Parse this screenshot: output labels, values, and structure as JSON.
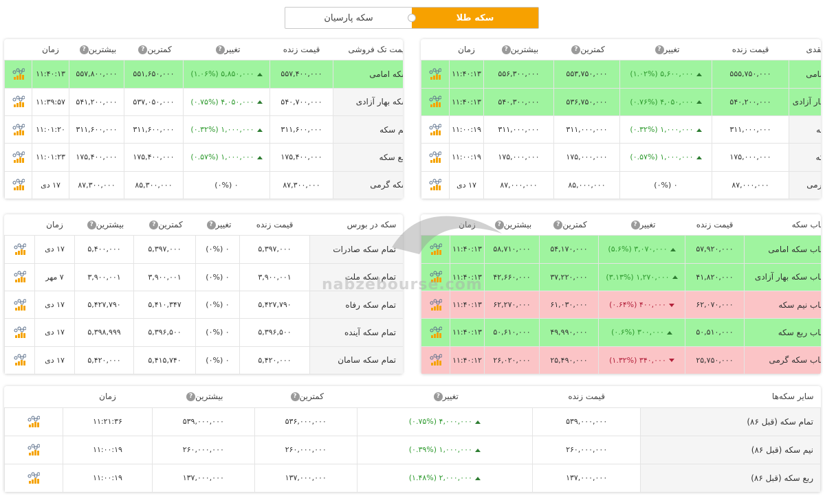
{
  "toggle": {
    "options": [
      "سکه طلا",
      "سکه پارسیان"
    ],
    "selected": "سکه طلا",
    "active_color": "#f7a100"
  },
  "colors": {
    "up_row": "#9ff49f",
    "down_row": "#fbc4c6",
    "up_text": "#2e9a2e",
    "down_text": "#b3203a"
  },
  "tables": {
    "cash": {
      "headers": [
        "قیمت نقدی",
        "قیمت زنده",
        "تغییر",
        "کمترین",
        "بیشترین",
        "زمان"
      ],
      "rows": [
        {
          "name": "سکه امامی",
          "live": "۵۵۵,۷۵۰,۰۰۰",
          "change": "۵,۶۰۰,۰۰۰ (۱.۰۲%)",
          "dir": "up",
          "low": "۵۵۳,۷۵۰,۰۰۰",
          "high": "۵۵۶,۳۰۰,۰۰۰",
          "time": "۱۱:۴۰:۱۳",
          "row_state": "up"
        },
        {
          "name": "سکه بهار آزادی",
          "live": "۵۴۰,۲۰۰,۰۰۰",
          "change": "۴,۰۵۰,۰۰۰ (۰.۷۶%)",
          "dir": "up",
          "low": "۵۳۶,۷۵۰,۰۰۰",
          "high": "۵۴۰,۳۰۰,۰۰۰",
          "time": "۱۱:۴۰:۱۳",
          "row_state": "up"
        },
        {
          "name": "نیم سکه",
          "live": "۳۱۱,۰۰۰,۰۰۰",
          "change": "۱,۰۰۰,۰۰۰ (۰.۳۲%)",
          "dir": "up",
          "low": "۳۱۱,۰۰۰,۰۰۰",
          "high": "۳۱۱,۰۰۰,۰۰۰",
          "time": "۱۱:۰۰:۱۹",
          "row_state": "none"
        },
        {
          "name": "ربع سکه",
          "live": "۱۷۵,۰۰۰,۰۰۰",
          "change": "۱,۰۰۰,۰۰۰ (۰.۵۷%)",
          "dir": "up",
          "low": "۱۷۵,۰۰۰,۰۰۰",
          "high": "۱۷۵,۰۰۰,۰۰۰",
          "time": "۱۱:۰۰:۱۹",
          "row_state": "none"
        },
        {
          "name": "سکه گرمی",
          "live": "۸۷,۰۰۰,۰۰۰",
          "change": "۰ (۰%)",
          "dir": "none",
          "low": "۸۵,۰۰۰,۰۰۰",
          "high": "۸۷,۰۰۰,۰۰۰",
          "time": "۱۷ دی",
          "row_state": "none"
        }
      ]
    },
    "retail": {
      "headers": [
        "قیمت تک فروشی",
        "قیمت زنده",
        "تغییر",
        "کمترین",
        "بیشترین",
        "زمان"
      ],
      "rows": [
        {
          "name": "سکه امامی",
          "live": "۵۵۷,۴۰۰,۰۰۰",
          "change": "۵,۸۵۰,۰۰۰ (۱.۰۶%)",
          "dir": "up",
          "low": "۵۵۱,۶۵۰,۰۰۰",
          "high": "۵۵۷,۸۰۰,۰۰۰",
          "time": "۱۱:۴۰:۱۳",
          "row_state": "up"
        },
        {
          "name": "سکه بهار آزادی",
          "live": "۵۴۰,۷۰۰,۰۰۰",
          "change": "۴,۰۵۰,۰۰۰ (۰.۷۵%)",
          "dir": "up",
          "low": "۵۳۷,۰۵۰,۰۰۰",
          "high": "۵۴۱,۲۰۰,۰۰۰",
          "time": "۱۱:۳۹:۵۷",
          "row_state": "none"
        },
        {
          "name": "نیم سکه",
          "live": "۳۱۱,۶۰۰,۰۰۰",
          "change": "۱,۰۰۰,۰۰۰ (۰.۳۲%)",
          "dir": "up",
          "low": "۳۱۱,۶۰۰,۰۰۰",
          "high": "۳۱۱,۶۰۰,۰۰۰",
          "time": "۱۱:۰۱:۲۰",
          "row_state": "none"
        },
        {
          "name": "ربع سکه",
          "live": "۱۷۵,۴۰۰,۰۰۰",
          "change": "۱,۰۰۰,۰۰۰ (۰.۵۷%)",
          "dir": "up",
          "low": "۱۷۵,۴۰۰,۰۰۰",
          "high": "۱۷۵,۴۰۰,۰۰۰",
          "time": "۱۱:۰۱:۲۳",
          "row_state": "none"
        },
        {
          "name": "سکه گرمی",
          "live": "۸۷,۳۰۰,۰۰۰",
          "change": "۰ (۰%)",
          "dir": "none",
          "low": "۸۵,۳۰۰,۰۰۰",
          "high": "۸۷,۳۰۰,۰۰۰",
          "time": "۱۷ دی",
          "row_state": "none"
        }
      ]
    },
    "bubble": {
      "headers": [
        "حباب سکه",
        "قیمت زنده",
        "تغییر",
        "کمترین",
        "بیشترین",
        "زمان"
      ],
      "rows": [
        {
          "name": "حباب سکه امامی",
          "live": "۵۷,۹۲۰,۰۰۰",
          "change": "۳,۰۷۰,۰۰۰ (۵.۶%)",
          "dir": "up",
          "low": "۵۴,۱۷۰,۰۰۰",
          "high": "۵۸,۷۱۰,۰۰۰",
          "time": "۱۱:۴۰:۱۳",
          "row_state": "up"
        },
        {
          "name": "حباب سکه بهار آزادی",
          "live": "۴۱,۸۲۰,۰۰۰",
          "change": "۱,۲۷۰,۰۰۰ (۳.۱۳%)",
          "dir": "up",
          "low": "۳۷,۲۲۰,۰۰۰",
          "high": "۴۲,۶۶۰,۰۰۰",
          "time": "۱۱:۴۰:۱۳",
          "row_state": "up"
        },
        {
          "name": "حباب نیم سکه",
          "live": "۶۲,۰۷۰,۰۰۰",
          "change": "۴۰۰,۰۰۰ (۰.۶۴%)",
          "dir": "down",
          "low": "۶۱,۰۳۰,۰۰۰",
          "high": "۶۲,۲۷۰,۰۰۰",
          "time": "۱۱:۴۰:۱۳",
          "row_state": "down"
        },
        {
          "name": "حباب ربع سکه",
          "live": "۵۰,۵۱۰,۰۰۰",
          "change": "۳۰۰,۰۰۰ (۰.۶%)",
          "dir": "up",
          "low": "۴۹,۹۹۰,۰۰۰",
          "high": "۵۰,۶۱۰,۰۰۰",
          "time": "۱۱:۴۰:۱۳",
          "row_state": "up"
        },
        {
          "name": "حباب سکه گرمی",
          "live": "۲۵,۷۵۰,۰۰۰",
          "change": "۳۴۰,۰۰۰ (۱.۳۲%)",
          "dir": "down",
          "low": "۲۵,۴۹۰,۰۰۰",
          "high": "۲۶,۰۲۰,۰۰۰",
          "time": "۱۱:۴۰:۱۲",
          "row_state": "down"
        }
      ]
    },
    "exchange": {
      "headers": [
        "سکه در بورس",
        "قیمت زنده",
        "تغییر",
        "کمترین",
        "بیشترین",
        "زمان"
      ],
      "rows": [
        {
          "name": "تمام سکه صادرات",
          "live": "۵,۳۹۷,۰۰۰",
          "change": "۰ (۰%)",
          "dir": "none",
          "low": "۵,۳۹۷,۰۰۰",
          "high": "۵,۴۰۰,۰۰۰",
          "time": "۱۷ دی",
          "row_state": "none"
        },
        {
          "name": "تمام سکه ملت",
          "live": "۳,۹۰۰,۰۰۱",
          "change": "۰ (۰%)",
          "dir": "none",
          "low": "۳,۹۰۰,۰۰۱",
          "high": "۳,۹۰۰,۰۰۱",
          "time": "۷ مهر",
          "row_state": "none"
        },
        {
          "name": "تمام سکه رفاه",
          "live": "۵,۴۲۷,۷۹۰",
          "change": "۰ (۰%)",
          "dir": "none",
          "low": "۵,۴۱۰,۳۴۷",
          "high": "۵,۴۲۷,۷۹۰",
          "time": "۱۷ دی",
          "row_state": "none"
        },
        {
          "name": "تمام سکه آینده",
          "live": "۵,۳۹۶,۵۰۰",
          "change": "۰ (۰%)",
          "dir": "none",
          "low": "۵,۳۹۶,۵۰۰",
          "high": "۵,۳۹۸,۹۹۹",
          "time": "۱۷ دی",
          "row_state": "none"
        },
        {
          "name": "تمام سکه سامان",
          "live": "۵,۴۲۰,۰۰۰",
          "change": "۰ (۰%)",
          "dir": "none",
          "low": "۵,۴۱۵,۷۴۰",
          "high": "۵,۴۲۰,۰۰۰",
          "time": "۱۷ دی",
          "row_state": "none"
        }
      ]
    },
    "other": {
      "headers": [
        "سایر سکه‌ها",
        "قیمت زنده",
        "تغییر",
        "کمترین",
        "بیشترین",
        "زمان"
      ],
      "rows": [
        {
          "name": "تمام سکه (قبل ۸۶)",
          "live": "۵۳۹,۰۰۰,۰۰۰",
          "change": "۴,۰۰۰,۰۰۰ (۰.۷۵%)",
          "dir": "up",
          "low": "۵۳۶,۰۰۰,۰۰۰",
          "high": "۵۳۹,۰۰۰,۰۰۰",
          "time": "۱۱:۲۱:۳۶",
          "row_state": "none"
        },
        {
          "name": "نیم سکه (قبل ۸۶)",
          "live": "۲۶۰,۰۰۰,۰۰۰",
          "change": "۱,۰۰۰,۰۰۰ (۰.۳۹%)",
          "dir": "up",
          "low": "۲۶۰,۰۰۰,۰۰۰",
          "high": "۲۶۰,۰۰۰,۰۰۰",
          "time": "۱۱:۰۰:۱۹",
          "row_state": "none"
        },
        {
          "name": "ربع سکه (قبل ۸۶)",
          "live": "۱۳۷,۰۰۰,۰۰۰",
          "change": "۲,۰۰۰,۰۰۰ (۱.۴۸%)",
          "dir": "up",
          "low": "۱۳۷,۰۰۰,۰۰۰",
          "high": "۱۳۷,۰۰۰,۰۰۰",
          "time": "۱۱:۰۰:۱۹",
          "row_state": "none"
        }
      ]
    }
  },
  "icons": {
    "help": "question-circle-icon",
    "chart": "chart-icon",
    "up": "arrow-up-icon",
    "down": "arrow-down-icon"
  },
  "watermark": {
    "text": "nabzebourse.com"
  }
}
